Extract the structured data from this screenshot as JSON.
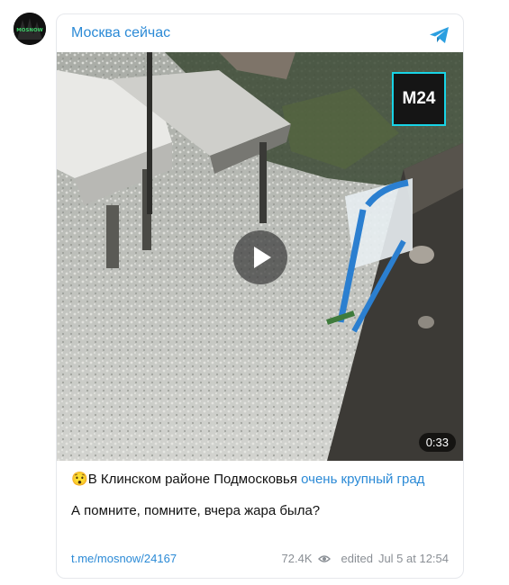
{
  "avatar": {
    "text": "MOSNOW"
  },
  "channel": {
    "name": "Москва сейчас"
  },
  "video": {
    "duration": "0:33",
    "badge": "M24"
  },
  "post": {
    "emoji": "😯",
    "text_plain": "В Клинском районе Подмосковья ",
    "text_link": "очень крупный град",
    "text_second": "А помните, помните, вчера жара была?"
  },
  "footer": {
    "link": "t.me/mosnow/24167",
    "views": "72.4K",
    "edited": "edited",
    "date": "Jul 5 at 12:54"
  },
  "colors": {
    "accent": "#2b8ad6",
    "badge_border": "#18d4e6"
  }
}
